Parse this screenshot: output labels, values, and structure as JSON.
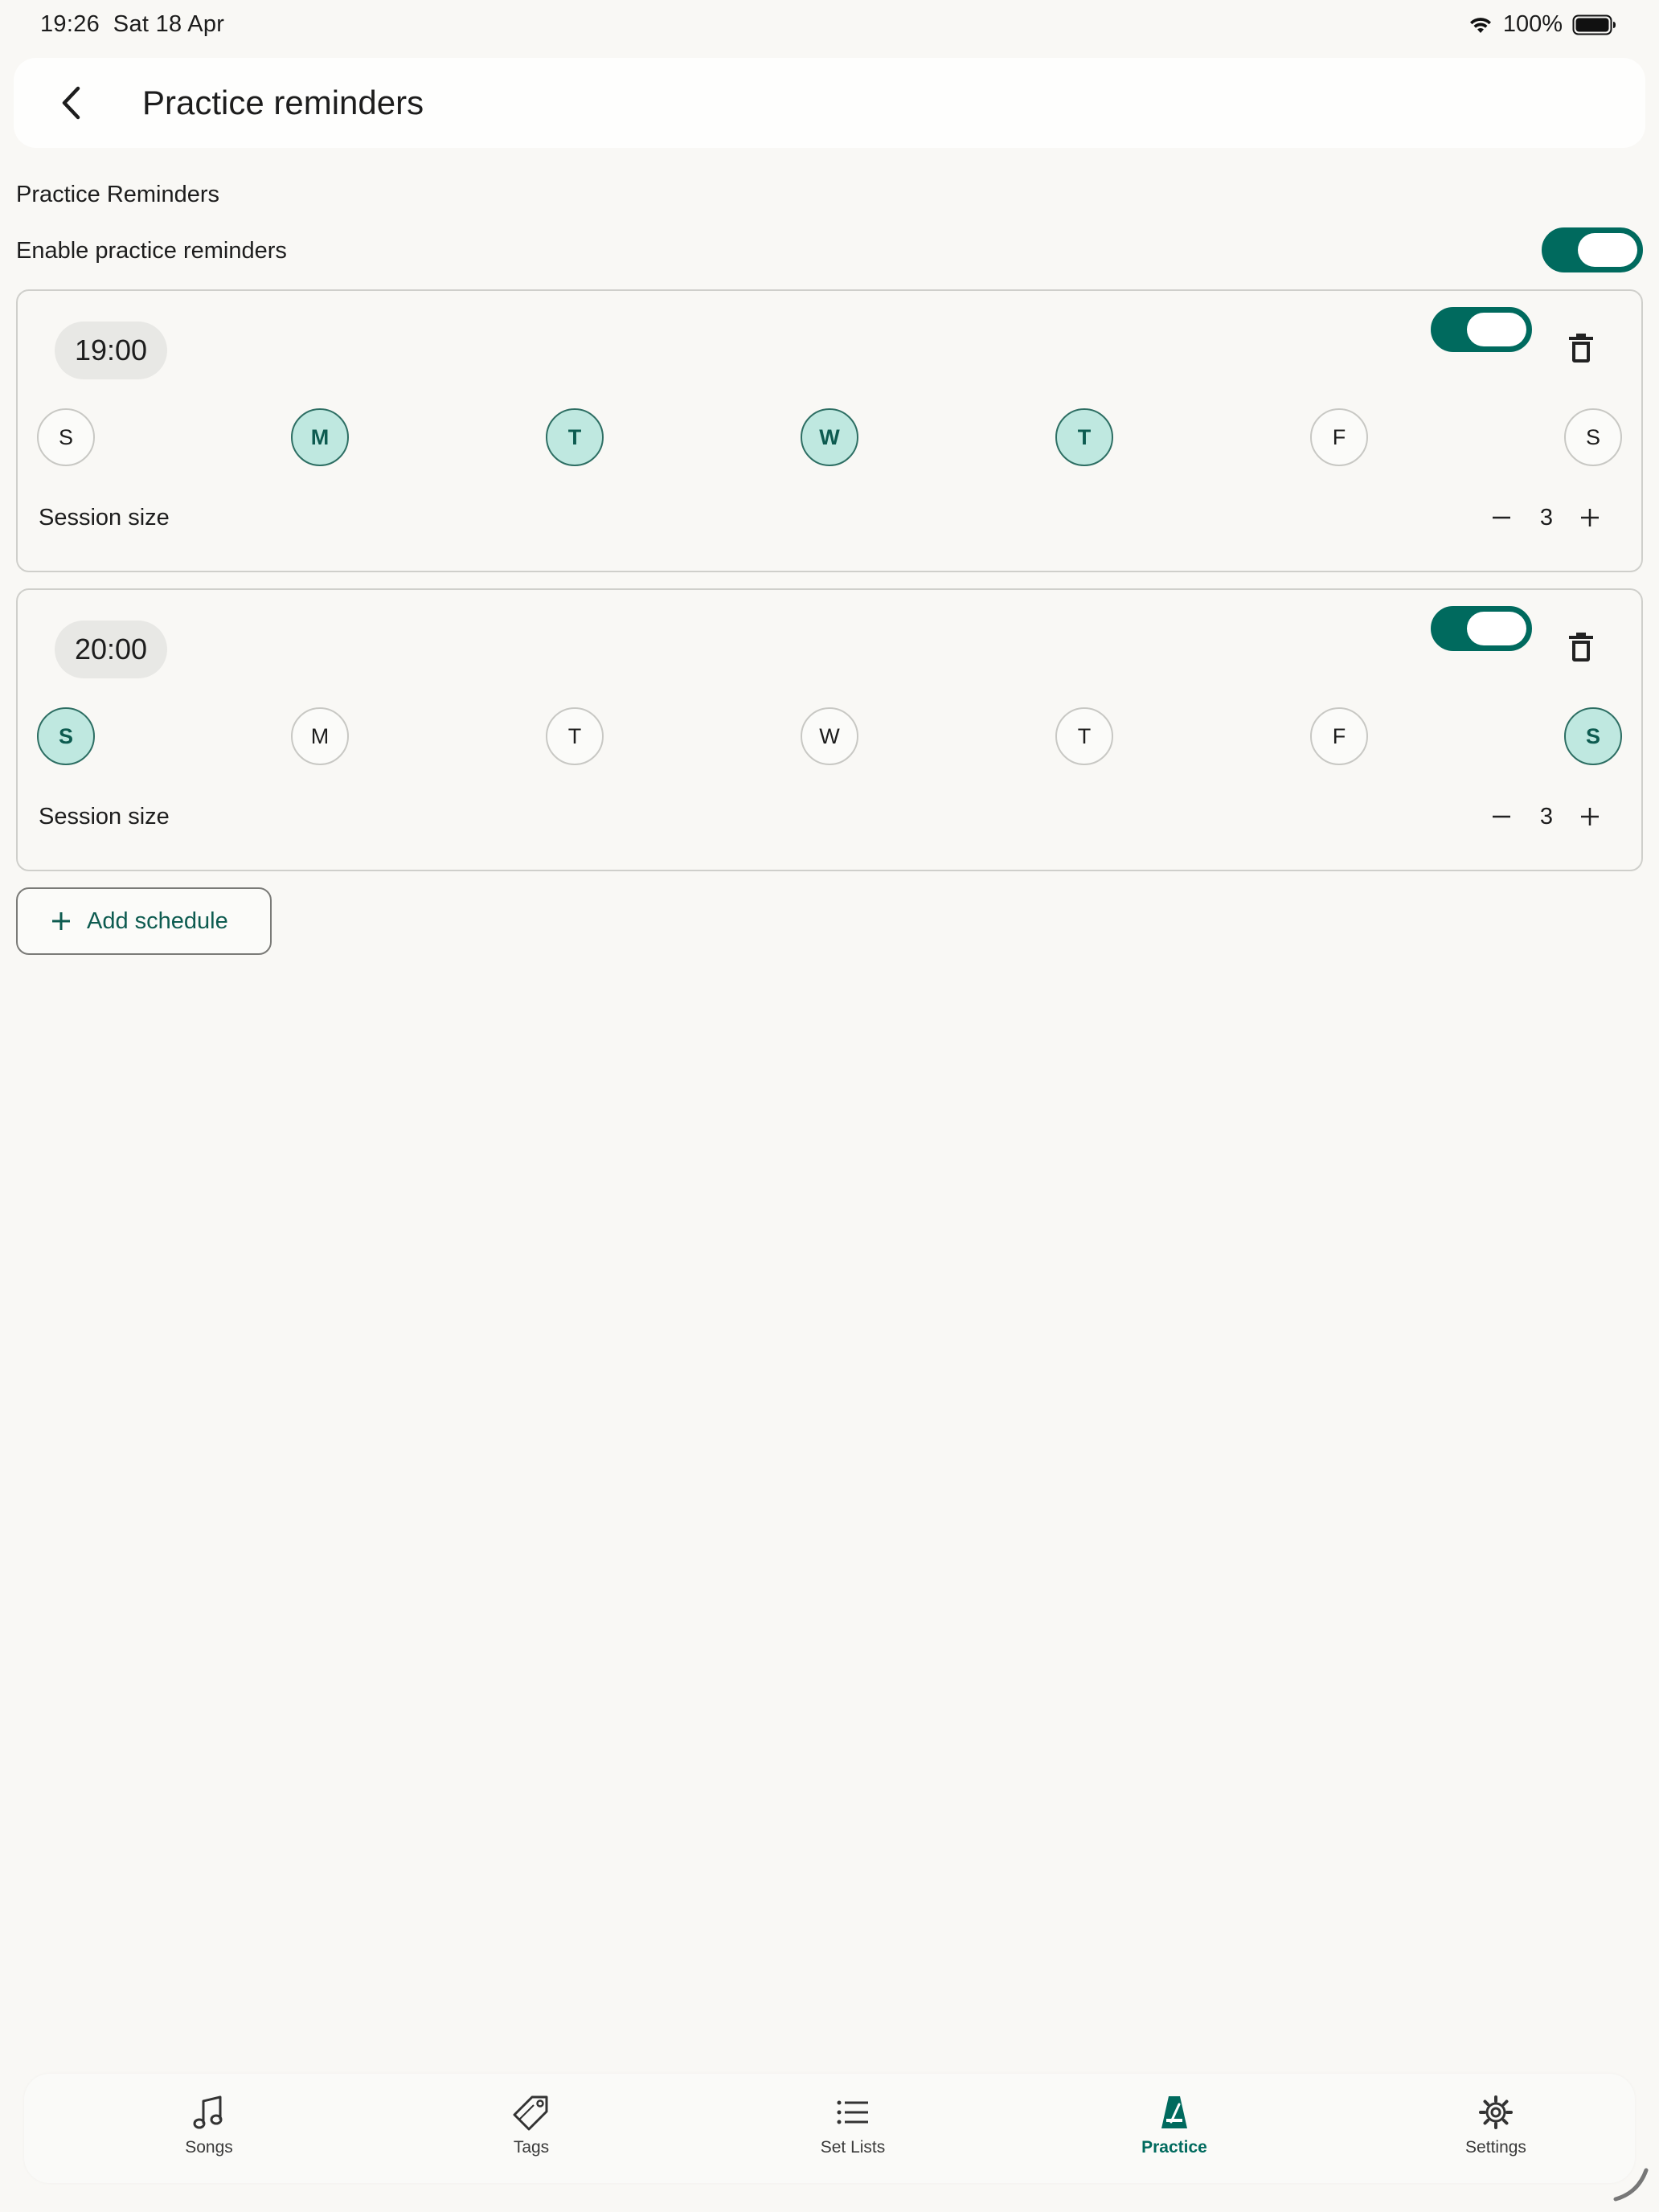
{
  "status_bar": {
    "time": "19:26",
    "date": "Sat 18 Apr",
    "battery": "100%"
  },
  "header": {
    "title": "Practice reminders",
    "back_icon": "chevron-left-icon"
  },
  "section_title": "Practice Reminders",
  "enable_label": "Enable practice reminders",
  "enable_on": true,
  "colors": {
    "accent": "#006a5e",
    "day_selected_bg": "#bfe8e0",
    "background": "#f9f8f5"
  },
  "schedules": [
    {
      "time": "19:00",
      "enabled": true,
      "days": [
        {
          "label": "S",
          "selected": false
        },
        {
          "label": "M",
          "selected": true
        },
        {
          "label": "T",
          "selected": true
        },
        {
          "label": "W",
          "selected": true
        },
        {
          "label": "T",
          "selected": true
        },
        {
          "label": "F",
          "selected": false
        },
        {
          "label": "S",
          "selected": false
        }
      ],
      "session_label": "Session size",
      "session_size": "3"
    },
    {
      "time": "20:00",
      "enabled": true,
      "days": [
        {
          "label": "S",
          "selected": true
        },
        {
          "label": "M",
          "selected": false
        },
        {
          "label": "T",
          "selected": false
        },
        {
          "label": "W",
          "selected": false
        },
        {
          "label": "T",
          "selected": false
        },
        {
          "label": "F",
          "selected": false
        },
        {
          "label": "S",
          "selected": true
        }
      ],
      "session_label": "Session size",
      "session_size": "3"
    }
  ],
  "add_schedule_label": "Add schedule",
  "nav": {
    "songs": "Songs",
    "tags": "Tags",
    "setlists": "Set Lists",
    "practice": "Practice",
    "settings": "Settings",
    "active": "practice"
  }
}
